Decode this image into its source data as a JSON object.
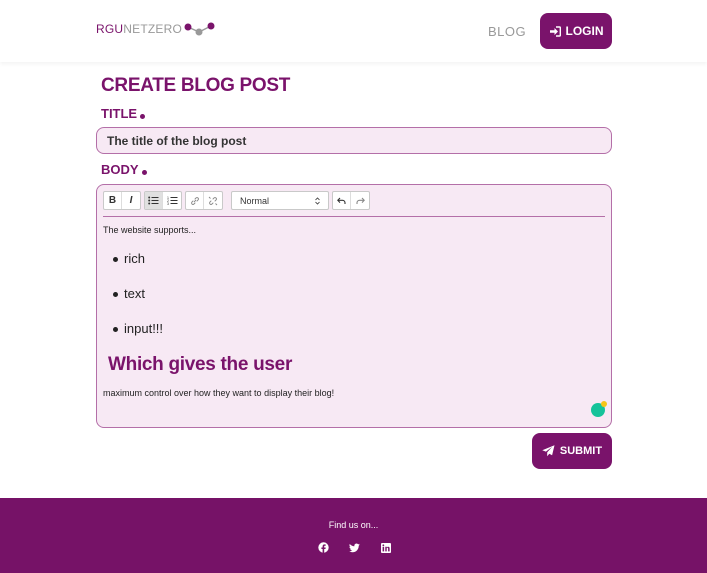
{
  "header": {
    "logo_part1": "RGU",
    "logo_part2": "NETZERO",
    "nav_blog": "BLOG",
    "login_label": "LOGIN"
  },
  "page": {
    "title": "CREATE BLOG POST",
    "title_label": "TITLE",
    "title_value": "The title of the blog post",
    "body_label": "BODY"
  },
  "editor": {
    "toolbar": {
      "bold": "B",
      "italic": "I",
      "format_select": "Normal"
    },
    "paragraph1": "The website supports...",
    "bullets": [
      "rich",
      "text",
      "input!!!"
    ],
    "heading": "Which gives the user",
    "paragraph2": "maximum control over how they want to display their blog!"
  },
  "submit_label": "SUBMIT",
  "footer": {
    "text": "Find us on..."
  },
  "colors": {
    "brand": "#7a136b",
    "field_bg": "#f7e9f4",
    "field_border": "#b46fa8",
    "footer_bg": "#761267"
  }
}
